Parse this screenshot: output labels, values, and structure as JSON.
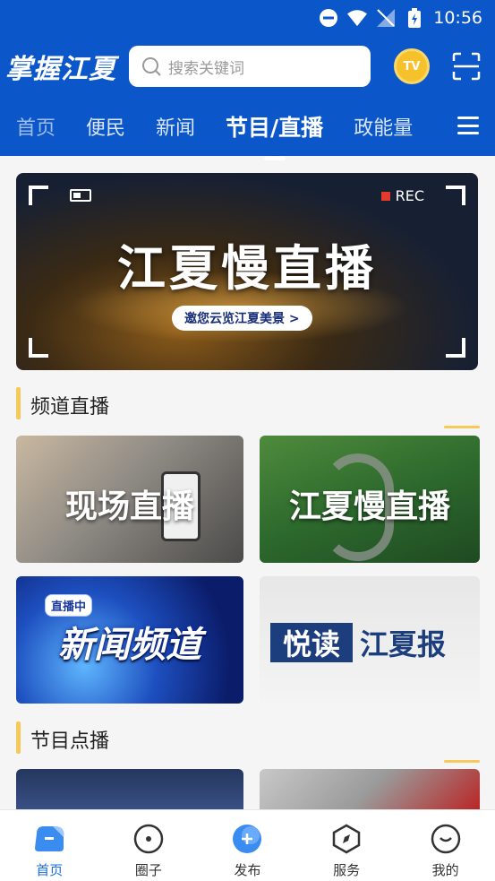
{
  "status_bar": {
    "time": "10:56"
  },
  "header": {
    "logo": "掌握江夏",
    "search_placeholder": "搜索关键词",
    "tv_label": "TV"
  },
  "tabs": [
    {
      "label": "首页"
    },
    {
      "label": "便民"
    },
    {
      "label": "新闻"
    },
    {
      "label": "节目/直播",
      "active": true
    },
    {
      "label": "政能量"
    }
  ],
  "banner": {
    "title": "江夏慢直播",
    "pill": "邀您云览江夏美景 >",
    "rec": "REC"
  },
  "sections": {
    "channel_live": "频道直播",
    "vod": "节目点播"
  },
  "cards": {
    "live_scene": "现场直播",
    "slow_live": "江夏慢直播",
    "news_channel": "新闻频道",
    "news_live_tag": "直播中",
    "read_a": "悦读",
    "read_b": "江夏报"
  },
  "bottom_nav": [
    {
      "label": "首页",
      "icon": "home-icon",
      "active": true
    },
    {
      "label": "圈子",
      "icon": "circle-icon"
    },
    {
      "label": "发布",
      "icon": "publish-icon"
    },
    {
      "label": "服务",
      "icon": "service-icon"
    },
    {
      "label": "我的",
      "icon": "profile-icon"
    }
  ],
  "colors": {
    "brand_blue": "#0b57c9",
    "accent_yellow": "#f6c95a",
    "active_nav": "#1a6fe0"
  }
}
